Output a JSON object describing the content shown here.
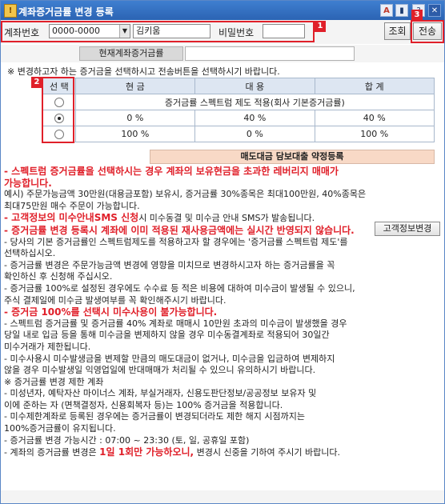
{
  "window": {
    "title": "계좌증거금률 변경 등록",
    "icon_char": "!",
    "tb_a": "A",
    "tb_b": "▮",
    "tb_help": "?",
    "tb_close": "✕"
  },
  "toolbar": {
    "account_label": "계좌번호",
    "account_value": "0000-0000",
    "name_value": "김키움",
    "password_label": "비밀번호",
    "query_button": "조회",
    "send_button": "전송",
    "badges": [
      "1",
      "2",
      "3"
    ]
  },
  "current_rate": {
    "label": "현재계좌증거금률",
    "value": ""
  },
  "instruction": "※ 변경하고자 하는 증거금을 선택하시고 전송버튼을 선택하시기 바랍니다.",
  "table": {
    "headers": [
      "선 택",
      "현 금",
      "대 용",
      "합 계"
    ],
    "rows": [
      {
        "selected": false,
        "merged": "증거금률 스펙트럼 제도 적용(회사 기본증거금률)"
      },
      {
        "selected": true,
        "cash": "0 %",
        "sub": "40 %",
        "total": "40 %"
      },
      {
        "selected": false,
        "cash": "100 %",
        "sub": "0 %",
        "total": "100 %"
      }
    ]
  },
  "subheader": "매도대금 담보대출 약정등록",
  "info_button": "고객정보변경",
  "lines": [
    {
      "t": "- 스펙트럼 증거금률을 선택하시는 경우 계좌의 보유현금을 초과한 레버리지 매매가",
      "s": "red"
    },
    {
      "t": "  가능합니다.",
      "s": "red"
    },
    {
      "t": "  예시) 주문가능금액 30만원(대용금포함) 보유시, 증거금률 30%종목은 최대100만원, 40%종목은",
      "s": ""
    },
    {
      "t": "  최대75만원 매수 주문이 가능합니다.",
      "s": ""
    },
    {
      "t": "- 고객정보의 미수안내SMS 신청시 미수동결 및 미수금 안내 SMS가 발송됩니다.",
      "s": "mix"
    },
    {
      "t": "- 증거금률 변경 등록시 계좌에 이미 적용된 재사용금액에는 실시간 반영되지 않습니다.",
      "s": "red"
    },
    {
      "t": "- 당사의 기본 증거금률인 스펙트럼제도를 적용하고자 할 경우에는 '증거금률 스펙트럼 제도'를",
      "s": ""
    },
    {
      "t": "  선택하십시오.",
      "s": ""
    },
    {
      "t": "- 증거금률 변경은 주문가능금액 변경에 영향을 미치므로 변경하시고자 하는 증거금률을  꼭",
      "s": ""
    },
    {
      "t": "  확인하신 후 신청해 주십시오.",
      "s": ""
    },
    {
      "t": "- 증거금률 100%로 설정된 경우에도 수수료 등 적은 비용에 대하여 미수금이 발생될 수 있으니,",
      "s": ""
    },
    {
      "t": "  주식 결제일에 미수금 발생여부를 꼭 확인해주시기 바랍니다.",
      "s": ""
    },
    {
      "t": "- 증거금 100%를 선택시 미수사용이 불가능합니다.",
      "s": "red"
    },
    {
      "t": "- 스펙트럼 증거금률 및 증거금률 40% 계좌로 매매시 10만원 초과의 미수금이 발생했을 경우",
      "s": ""
    },
    {
      "t": "  당일 내로 입금 등을 통해 미수금을 변제하지 않을 경우 미수동결계좌로 적용되어 30일간",
      "s": ""
    },
    {
      "t": "  미수거래가 제한됩니다.",
      "s": ""
    },
    {
      "t": "- 미수사용시 미수발생금을 변제할 만큼의 매도대금이 없거나, 미수금을 입금하여 변제하지",
      "s": ""
    },
    {
      "t": "  않을 경우 미수발생일 익영업일에 반대매매가 처리될 수 있으니 유의하시기 바랍니다.",
      "s": ""
    },
    {
      "t": "※ 증거금률 변경 제한 계좌",
      "s": ""
    },
    {
      "t": "    - 미성년자, 예탁자산 마이너스 계좌, 부실거래자, 신용도판단정보/공공정보 보유자 및",
      "s": ""
    },
    {
      "t": "      이에 준하는 자 (면책결정자, 신용회복자 등)는 100% 증거금을 적용합니다.",
      "s": ""
    },
    {
      "t": "    - 미수제한계좌로 등록된 경우에는 증거금률이 변경되더라도 제한 해지 시점까지는",
      "s": ""
    },
    {
      "t": "      100%증거금률이 유지됩니다.",
      "s": ""
    },
    {
      "t": "- 증거금률 변경 가능시간 : 07:00 ~ 23:30 (토, 일, 공휴일 포함)",
      "s": ""
    },
    {
      "t": "- 계좌의 증거금률 변경은 1일 1회만 가능하오니, 변경시 신중을 기하여 주시기 바랍니다.",
      "s": "mix2"
    }
  ],
  "mix": {
    "red_part": "- 고객정보의 미수안내SMS 신청",
    "rest": "시 미수동결 및 미수금 안내 SMS가 발송됩니다."
  },
  "mix2": {
    "pre": "- 계좌의 증거금률 변경은 ",
    "red_part": "1일 1회만 가능하오니,",
    "post": " 변경시 신중을 기하여 주시기 바랍니다."
  }
}
